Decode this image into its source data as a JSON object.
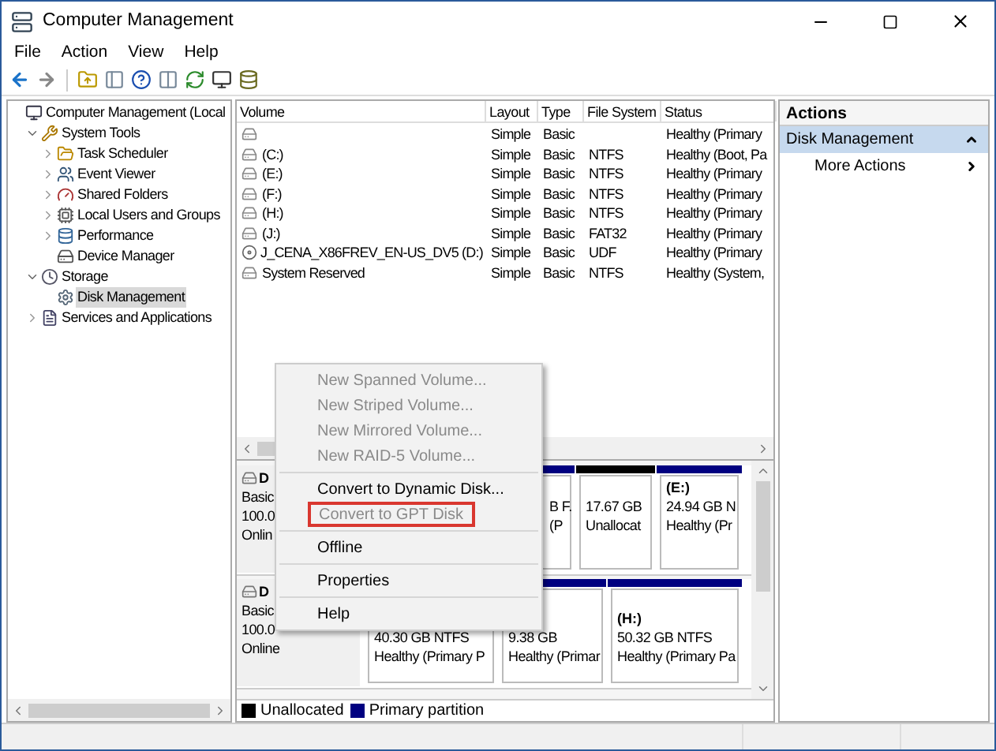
{
  "window": {
    "title": "Computer Management"
  },
  "menu_bar": [
    "File",
    "Action",
    "View",
    "Help"
  ],
  "tree": [
    {
      "label": "Computer Management (Local",
      "selected": false,
      "children": [
        {
          "label": "System Tools",
          "selected": false,
          "expanded": true,
          "children": [
            {
              "label": "Task Scheduler",
              "selected": false,
              "expanded": false
            },
            {
              "label": "Event Viewer",
              "selected": false,
              "expanded": false
            },
            {
              "label": "Shared Folders",
              "selected": false,
              "expanded": false
            },
            {
              "label": "Local Users and Groups",
              "selected": false,
              "expanded": false
            },
            {
              "label": "Performance",
              "selected": false,
              "expanded": false
            },
            {
              "label": "Device Manager",
              "selected": false
            }
          ]
        },
        {
          "label": "Storage",
          "selected": false,
          "expanded": true,
          "children": [
            {
              "label": "Disk Management",
              "selected": true
            }
          ]
        },
        {
          "label": "Services and Applications",
          "selected": false,
          "expanded": false
        }
      ]
    }
  ],
  "volumes": {
    "columns": [
      "Volume",
      "Layout",
      "Type",
      "File System",
      "Status"
    ],
    "rows": [
      {
        "kind": "disk",
        "cells": [
          "",
          "Simple",
          "Basic",
          "",
          "Healthy (Primary"
        ]
      },
      {
        "kind": "disk",
        "cells": [
          "(C:)",
          "Simple",
          "Basic",
          "NTFS",
          "Healthy (Boot, Pa"
        ]
      },
      {
        "kind": "disk",
        "cells": [
          "(E:)",
          "Simple",
          "Basic",
          "NTFS",
          "Healthy (Primary"
        ]
      },
      {
        "kind": "disk",
        "cells": [
          "(F:)",
          "Simple",
          "Basic",
          "NTFS",
          "Healthy (Primary"
        ]
      },
      {
        "kind": "disk",
        "cells": [
          "(H:)",
          "Simple",
          "Basic",
          "NTFS",
          "Healthy (Primary"
        ]
      },
      {
        "kind": "disk",
        "cells": [
          "(J:)",
          "Simple",
          "Basic",
          "FAT32",
          "Healthy (Primary"
        ]
      },
      {
        "kind": "optical",
        "cells": [
          "J_CENA_X86FREV_EN-US_DV5 (D:)",
          "Simple",
          "Basic",
          "UDF",
          "Healthy (Primary"
        ]
      },
      {
        "kind": "disk",
        "cells": [
          "System Reserved",
          "Simple",
          "Basic",
          "NTFS",
          "Healthy (System,"
        ]
      }
    ]
  },
  "disks": [
    {
      "label": [
        "D",
        "Basic",
        "100.0",
        "Onlin"
      ],
      "partitions": [
        {
          "color": "#000080",
          "lines": [
            "B F.",
            "(P"
          ]
        },
        {
          "color": "#000000",
          "lines": [
            "17.67 GB",
            "Unallocat"
          ]
        },
        {
          "color": "#000080",
          "letter": "(E:)",
          "lines": [
            "24.94 GB N",
            "Healthy (Pr"
          ]
        }
      ]
    },
    {
      "label": [
        "D",
        "Basic",
        "100.0",
        "Online"
      ],
      "partitions": [
        {
          "lines": [
            "40.30 GB NTFS",
            "Healthy (Primary P"
          ]
        },
        {
          "color": "#000080",
          "lines": [
            "9.38 GB",
            "Healthy (Primar"
          ]
        },
        {
          "color": "#000080",
          "letter": "(H:)",
          "lines": [
            "50.32 GB NTFS",
            "Healthy (Primary Pa"
          ]
        }
      ]
    }
  ],
  "legend": [
    {
      "color": "#000000",
      "label": "Unallocated"
    },
    {
      "color": "#000080",
      "label": "Primary partition"
    }
  ],
  "actions": {
    "title": "Actions",
    "items": [
      {
        "kind": "section",
        "label": "Disk Management",
        "selected": true
      },
      {
        "kind": "submenu",
        "label": "More Actions",
        "selected": false
      }
    ]
  },
  "context_menu": [
    [
      {
        "label": "New Spanned Volume...",
        "disabled": true,
        "highlighted": false
      },
      {
        "label": "New Striped Volume...",
        "disabled": true,
        "highlighted": false
      },
      {
        "label": "New Mirrored Volume...",
        "disabled": true,
        "highlighted": false
      },
      {
        "label": "New RAID-5 Volume...",
        "disabled": true,
        "highlighted": false
      }
    ],
    [
      {
        "label": "Convert to Dynamic Disk...",
        "disabled": false,
        "highlighted": false
      },
      {
        "label": "Convert to GPT Disk",
        "disabled": true,
        "highlighted": true
      }
    ],
    [
      {
        "label": "Offline",
        "disabled": false,
        "highlighted": false
      }
    ],
    [
      {
        "label": "Properties",
        "disabled": false,
        "highlighted": false
      }
    ],
    [
      {
        "label": "Help",
        "disabled": false,
        "highlighted": false
      }
    ]
  ]
}
